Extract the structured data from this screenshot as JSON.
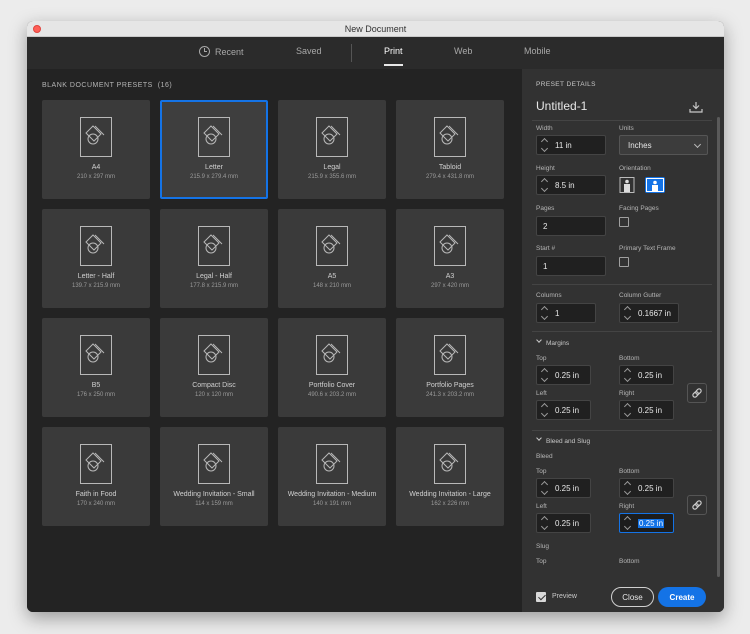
{
  "window": {
    "title": "New Document"
  },
  "tabs": [
    {
      "label": "Recent",
      "icon": "clock-icon"
    },
    {
      "label": "Saved"
    },
    {
      "label": "Print",
      "active": true
    },
    {
      "label": "Web"
    },
    {
      "label": "Mobile"
    }
  ],
  "presets": {
    "header": "BLANK DOCUMENT PRESETS",
    "count": "(16)",
    "items": [
      {
        "name": "A4",
        "dims": "210 x 297 mm"
      },
      {
        "name": "Letter",
        "dims": "215.9 x 279.4 mm",
        "selected": true
      },
      {
        "name": "Legal",
        "dims": "215.9 x 355.6 mm"
      },
      {
        "name": "Tabloid",
        "dims": "279.4 x 431.8 mm"
      },
      {
        "name": "Letter - Half",
        "dims": "139.7 x 215.9 mm"
      },
      {
        "name": "Legal - Half",
        "dims": "177.8 x 215.9 mm"
      },
      {
        "name": "A5",
        "dims": "148 x 210 mm"
      },
      {
        "name": "A3",
        "dims": "297 x 420 mm"
      },
      {
        "name": "B5",
        "dims": "176 x 250 mm"
      },
      {
        "name": "Compact Disc",
        "dims": "120 x 120 mm"
      },
      {
        "name": "Portfolio Cover",
        "dims": "490.6 x 203.2 mm"
      },
      {
        "name": "Portfolio Pages",
        "dims": "241.3 x 203.2 mm"
      },
      {
        "name": "Faith in Food",
        "dims": "170 x 240 mm"
      },
      {
        "name": "Wedding Invitation - Small",
        "dims": "114 x 159 mm"
      },
      {
        "name": "Wedding Invitation - Medium",
        "dims": "140 x 191 mm"
      },
      {
        "name": "Wedding Invitation - Large",
        "dims": "162 x 226 mm"
      }
    ]
  },
  "details": {
    "header": "PRESET DETAILS",
    "doc_name": "Untitled-1",
    "width_label": "Width",
    "width_value": "11 in",
    "units_label": "Units",
    "units_value": "Inches",
    "height_label": "Height",
    "height_value": "8.5 in",
    "orientation_label": "Orientation",
    "orientation_selected": "landscape",
    "pages_label": "Pages",
    "pages_value": "2",
    "facing_label": "Facing Pages",
    "facing_checked": false,
    "start_label": "Start #",
    "start_value": "1",
    "primary_label": "Primary Text Frame",
    "primary_checked": false,
    "columns_label": "Columns",
    "columns_value": "1",
    "gutter_label": "Column Gutter",
    "gutter_value": "0.1667 in",
    "margins": {
      "header": "Margins",
      "top_label": "Top",
      "top_value": "0.25 in",
      "bottom_label": "Bottom",
      "bottom_value": "0.25 in",
      "left_label": "Left",
      "left_value": "0.25 in",
      "right_label": "Right",
      "right_value": "0.25 in"
    },
    "bleed": {
      "header": "Bleed and Slug",
      "sub": "Bleed",
      "top_label": "Top",
      "top_value": "0.25 in",
      "bottom_label": "Bottom",
      "bottom_value": "0.25 in",
      "left_label": "Left",
      "left_value": "0.25 in",
      "right_label": "Right",
      "right_value": "0.25 in"
    },
    "slug": {
      "sub": "Slug",
      "top_label": "Top",
      "bottom_label": "Bottom"
    }
  },
  "footer": {
    "preview_label": "Preview",
    "preview_checked": true,
    "close_label": "Close",
    "create_label": "Create"
  },
  "colors": {
    "accent": "#1473e6",
    "panel": "#323232",
    "background": "#232323"
  }
}
